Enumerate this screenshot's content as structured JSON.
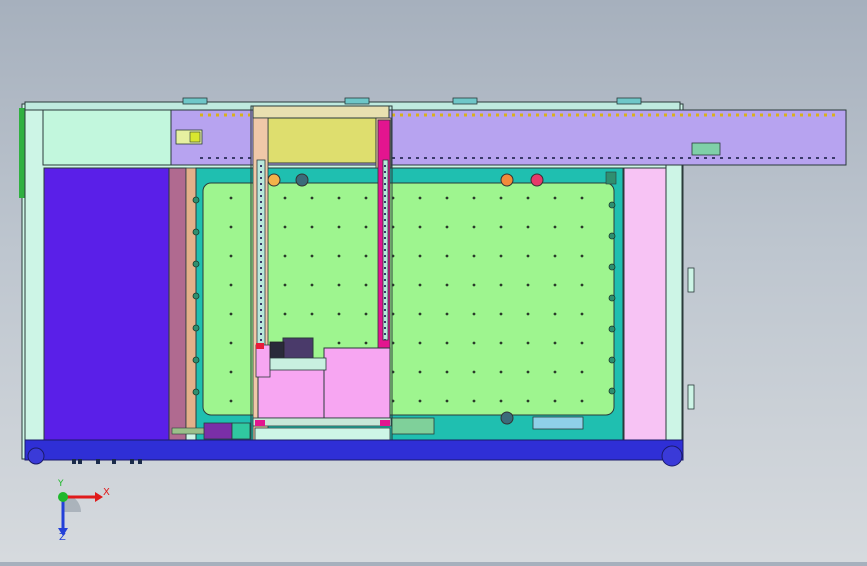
{
  "viewport": {
    "background_top": "#a6b0bd",
    "background_bottom": "#d6dade"
  },
  "triad": {
    "x_label": "X",
    "y_label": "Y",
    "z_label": "Z",
    "x_color": "#e01b1b",
    "y_color": "#1fb82b",
    "z_color": "#2340d8"
  },
  "colors": {
    "frame": "#cdf5e6",
    "gantry_beam": "#b7a3f0",
    "bed": "#9ef58f",
    "bed_border": "#1fbfb0",
    "column": "#5a1fe8",
    "column_bar": "#b06a90",
    "base": "#2f2fd6",
    "carriage_top": "#dede6e",
    "tool_head": "#f7a6f2",
    "magenta_rail": "#e3158f",
    "side_panel": "#f7c3f4"
  }
}
